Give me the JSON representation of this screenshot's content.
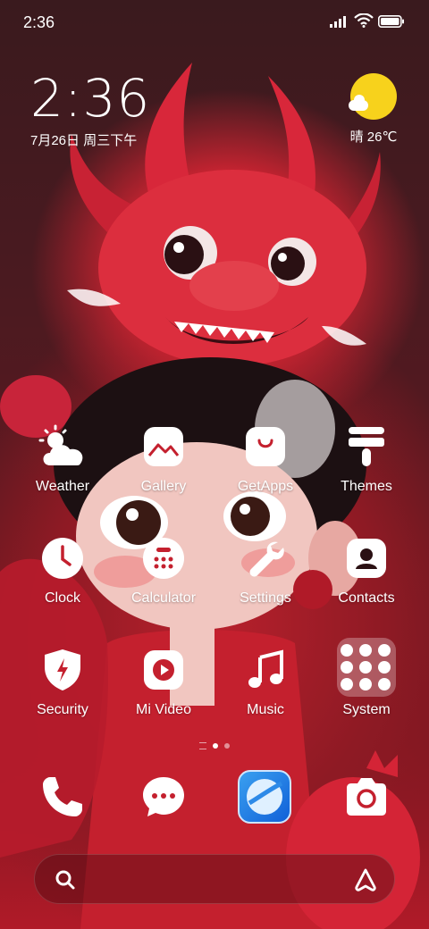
{
  "status_bar": {
    "time": "2:36"
  },
  "clock_widget": {
    "time": "2:36",
    "date": "7月26日 周三下午"
  },
  "weather_widget": {
    "text": "晴 26℃",
    "icon": "sunny-cloud-icon"
  },
  "apps": {
    "weather": {
      "label": "Weather",
      "icon": "weather-icon"
    },
    "gallery": {
      "label": "Gallery",
      "icon": "gallery-icon"
    },
    "getapps": {
      "label": "GetApps",
      "icon": "shopping-bag-icon"
    },
    "themes": {
      "label": "Themes",
      "icon": "paint-brush-icon"
    },
    "clock": {
      "label": "Clock",
      "icon": "clock-icon"
    },
    "calculator": {
      "label": "Calculator",
      "icon": "calculator-icon"
    },
    "settings": {
      "label": "Settings",
      "icon": "wrench-icon"
    },
    "contacts": {
      "label": "Contacts",
      "icon": "contacts-icon"
    },
    "security": {
      "label": "Security",
      "icon": "shield-icon"
    },
    "mivideo": {
      "label": "Mi Video",
      "icon": "play-icon"
    },
    "music": {
      "label": "Music",
      "icon": "music-note-icon"
    },
    "system": {
      "label": "System",
      "icon": "folder-icon"
    }
  },
  "dock": [
    "phone-icon",
    "messages-icon",
    "browser-icon",
    "camera-icon"
  ],
  "search_bar": {
    "left_icon": "search-icon",
    "right_icon": "assistant-icon"
  },
  "colors": {
    "accent_sun": "#f7d21c",
    "browser_blue": "#1e7ee8"
  }
}
